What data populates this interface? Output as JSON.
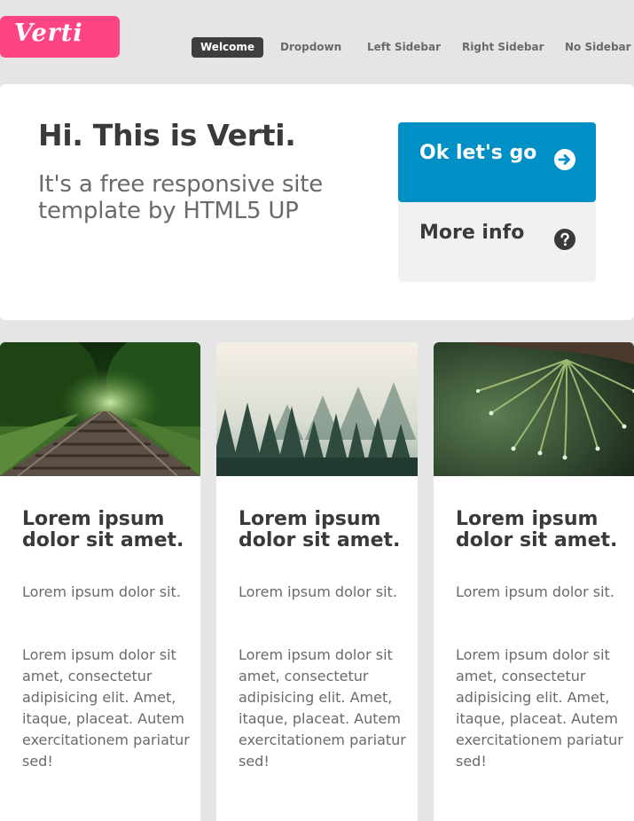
{
  "header": {
    "logo_text": "Verti",
    "brand_color": "#ff4486",
    "nav": [
      {
        "label": "Welcome",
        "active": true
      },
      {
        "label": "Dropdown",
        "active": false
      },
      {
        "label": "Left Sidebar",
        "active": false
      },
      {
        "label": "Right Sidebar",
        "active": false
      },
      {
        "label": "No Sidebar",
        "active": false
      }
    ]
  },
  "banner": {
    "title": "Hi. This is Verti.",
    "subtitle": "It's a free responsive site template by HTML5 UP",
    "primary_button": {
      "label": "Ok let's go",
      "icon": "arrow-right-circle-icon",
      "color": "#0090c5"
    },
    "secondary_button": {
      "label": "More info",
      "icon": "question-circle-icon"
    }
  },
  "cards": [
    {
      "image": "railroad-tracks-forest",
      "title": "Lorem ipsum dolor sit amet.",
      "subtitle": "Lorem ipsum dolor sit.",
      "text": "Lorem ipsum dolor sit amet, consectetur adipisicing elit. Amet, itaque, placeat. Autem exercitationem pariatur sed!"
    },
    {
      "image": "misty-pine-forest",
      "title": "Lorem ipsum dolor sit amet.",
      "subtitle": "Lorem ipsum dolor sit.",
      "text": "Lorem ipsum dolor sit amet, consectetur adipisicing elit. Amet, itaque, placeat. Autem exercitationem pariatur sed!"
    },
    {
      "image": "pine-needles-dewdrops",
      "title": "Lorem ipsum dolor sit amet.",
      "subtitle": "Lorem ipsum dolor sit.",
      "text": "Lorem ipsum dolor sit amet, consectetur adipisicing elit. Amet, itaque, placeat. Autem exercitationem pariatur sed!"
    }
  ]
}
